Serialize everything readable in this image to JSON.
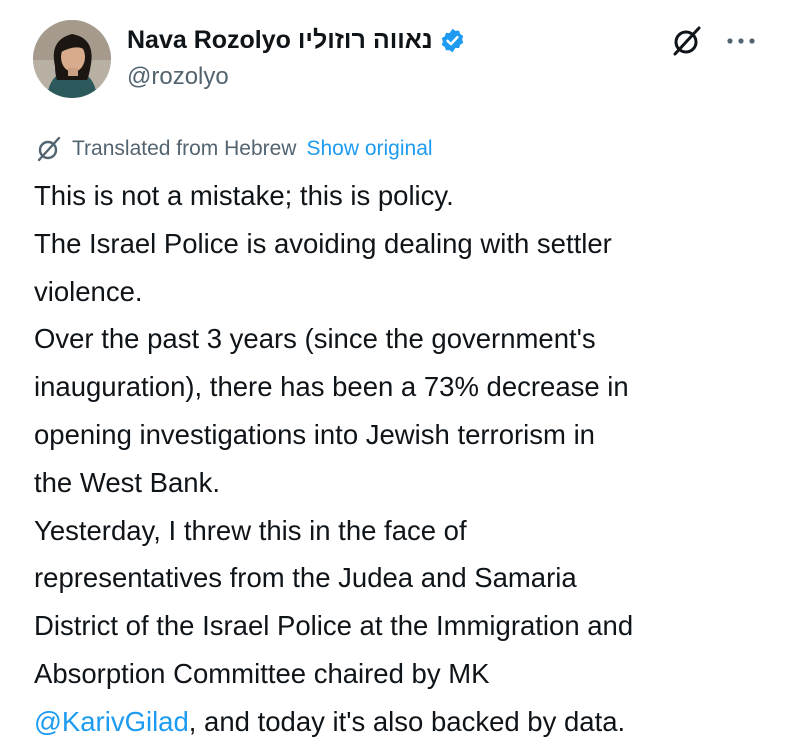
{
  "post": {
    "author": {
      "display_name": "Nava Rozolyo נאווה רוזוליו",
      "handle": "@rozolyo",
      "verified": true
    },
    "icons": {
      "avatar": "user-photo",
      "verified": "verified-badge-icon",
      "grok": "grok-icon",
      "more": "more-icon",
      "translate": "grok-translate-icon"
    },
    "translation": {
      "label": "Translated from Hebrew",
      "show_original": "Show original"
    },
    "body": {
      "line_1": "This is not a mistake; this is policy.",
      "line_2": "The Israel Police is avoiding dealing with settler",
      "line_3": "violence.",
      "line_4": "Over the past 3 years (since the government's",
      "line_5": "inauguration), there has been a 73% decrease in",
      "line_6": "opening investigations into Jewish terrorism in",
      "line_7": "the West Bank.",
      "line_8": "Yesterday, I threw this in the face of",
      "line_9": "representatives from the Judea and Samaria",
      "line_10": "District of the Israel Police at the Immigration and",
      "line_11": "Absorption Committee chaired by MK",
      "mention": "@KarivGilad",
      "line_12_rest": ", and today it's also backed by data."
    },
    "colors": {
      "text": "#0f1419",
      "secondary": "#536471",
      "link": "#1d9bf0",
      "verified": "#1d9bf0"
    }
  }
}
